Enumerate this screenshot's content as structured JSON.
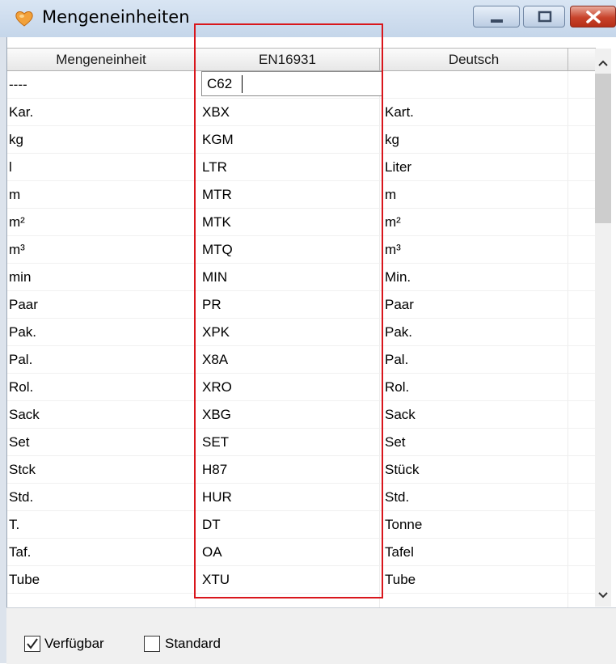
{
  "window": {
    "title": "Mengeneinheiten",
    "app_icon": "heart-icon",
    "buttons": [
      "minimize-icon",
      "maximize-icon",
      "close-icon"
    ]
  },
  "grid": {
    "columns": [
      "Mengeneinheit",
      "EN16931",
      "Deutsch"
    ],
    "editing_value": "C62",
    "rows": [
      {
        "unit": "----",
        "en": "C62",
        "de": ""
      },
      {
        "unit": "Kar.",
        "en": "XBX",
        "de": "Kart."
      },
      {
        "unit": "kg",
        "en": "KGM",
        "de": "kg"
      },
      {
        "unit": "l",
        "en": "LTR",
        "de": "Liter"
      },
      {
        "unit": "m",
        "en": "MTR",
        "de": "m"
      },
      {
        "unit": "m²",
        "en": "MTK",
        "de": "m²"
      },
      {
        "unit": "m³",
        "en": "MTQ",
        "de": "m³"
      },
      {
        "unit": "min",
        "en": "MIN",
        "de": "Min."
      },
      {
        "unit": "Paar",
        "en": "PR",
        "de": "Paar"
      },
      {
        "unit": "Pak.",
        "en": "XPK",
        "de": "Pak."
      },
      {
        "unit": "Pal.",
        "en": "X8A",
        "de": "Pal."
      },
      {
        "unit": "Rol.",
        "en": "XRO",
        "de": "Rol."
      },
      {
        "unit": "Sack",
        "en": "XBG",
        "de": "Sack"
      },
      {
        "unit": "Set",
        "en": "SET",
        "de": "Set"
      },
      {
        "unit": "Stck",
        "en": "H87",
        "de": "Stück"
      },
      {
        "unit": "Std.",
        "en": "HUR",
        "de": "Std."
      },
      {
        "unit": "T.",
        "en": "DT",
        "de": "Tonne"
      },
      {
        "unit": "Taf.",
        "en": "OA",
        "de": "Tafel"
      },
      {
        "unit": "Tube",
        "en": "XTU",
        "de": "Tube"
      }
    ]
  },
  "checkboxes": [
    {
      "label": "Verfügbar",
      "checked": true
    },
    {
      "label": "Standard",
      "checked": false
    }
  ],
  "colors": {
    "highlight": "#d9161c"
  }
}
